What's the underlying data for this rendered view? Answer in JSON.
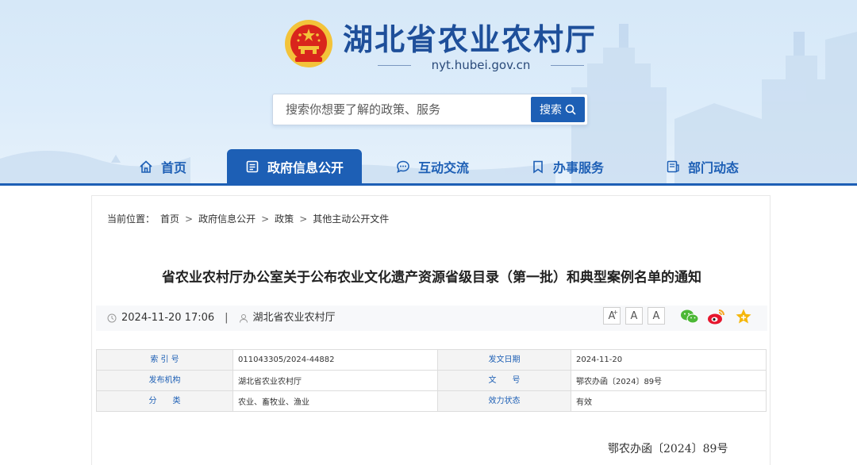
{
  "site": {
    "title": "湖北省农业农村厅",
    "domain": "nyt.hubei.gov.cn"
  },
  "search": {
    "placeholder": "搜索你想要了解的政策、服务",
    "button_label": "搜索"
  },
  "nav": {
    "items": [
      {
        "label": "首页",
        "icon": "home-icon",
        "active": false
      },
      {
        "label": "政府信息公开",
        "icon": "document-list-icon",
        "active": true
      },
      {
        "label": "互动交流",
        "icon": "chat-bubble-icon",
        "active": false
      },
      {
        "label": "办事服务",
        "icon": "bookmark-icon",
        "active": false
      },
      {
        "label": "部门动态",
        "icon": "news-icon",
        "active": false
      }
    ]
  },
  "breadcrumb": {
    "prefix": "当前位置：",
    "items": [
      "首页",
      "政府信息公开",
      "政策",
      "其他主动公开文件"
    ],
    "separator": ">"
  },
  "article": {
    "title": "省农业农村厅办公室关于公布农业文化遗产资源省级目录（第一批）和典型案例名单的通知",
    "datetime": "2024-11-20 17:06",
    "meta_separator": "|",
    "publisher": "湖北省农业农村厅",
    "doc_number": "鄂农办函〔2024〕89号"
  },
  "font_buttons": [
    {
      "label": "A",
      "mark": "+"
    },
    {
      "label": "A",
      "mark": ""
    },
    {
      "label": "A",
      "mark": ""
    }
  ],
  "share_icons": [
    "wechat-icon",
    "weibo-icon",
    "favorite-star-icon"
  ],
  "info_table": {
    "rows": [
      [
        "索 引 号",
        "011043305/2024-44882",
        "发文日期",
        "2024-11-20"
      ],
      [
        "发布机构",
        "湖北省农业农村厅",
        "文　　号",
        "鄂农办函〔2024〕89号"
      ],
      [
        "分　　类",
        "农业、畜牧业、渔业",
        "效力状态",
        "有效"
      ]
    ]
  },
  "colors": {
    "primary": "#1d5fb5",
    "title_blue": "#1e4f9a",
    "emblem_red": "#d9251c",
    "emblem_gold": "#f3c33a",
    "wechat_green": "#4cb836",
    "weibo_red": "#e6162d",
    "star_gold": "#f5b70c"
  }
}
